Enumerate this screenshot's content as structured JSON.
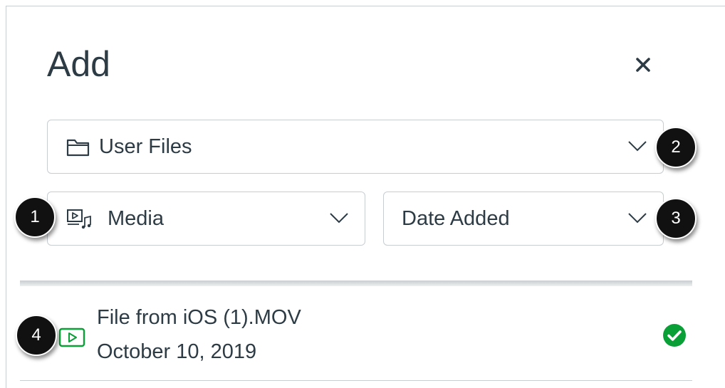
{
  "tray": {
    "title": "Add",
    "close_icon": "close-icon"
  },
  "source_select": {
    "value": "User Files",
    "icon": "folder-icon"
  },
  "type_select": {
    "value": "Media",
    "icon": "media-icon"
  },
  "sort_select": {
    "value": "Date Added"
  },
  "callouts": [
    "1",
    "2",
    "3",
    "4"
  ],
  "files": [
    {
      "name": "File from iOS (1).MOV",
      "date": "October 10, 2019",
      "icon": "video-file-icon",
      "status_icon": "check-circle-icon"
    }
  ],
  "colors": {
    "text": "#2d3b45",
    "border": "#c7cdd1",
    "success": "#0b9f38",
    "callout": "#111111"
  }
}
